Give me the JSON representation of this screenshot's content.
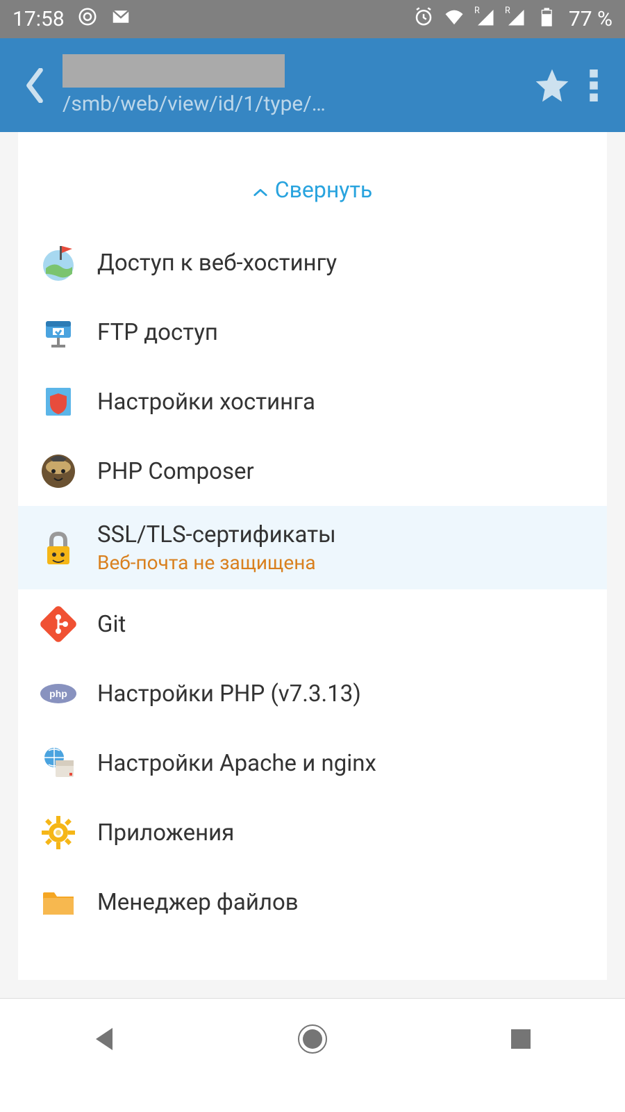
{
  "status": {
    "time": "17:58",
    "battery": "77 %"
  },
  "header": {
    "path": "/smb/web/view/id/1/type/…"
  },
  "collapse": {
    "label": "Свернуть"
  },
  "menu": [
    {
      "label": "Доступ к веб-хостингу",
      "icon": "globe-flag",
      "sublabel": null,
      "selected": false
    },
    {
      "label": "FTP доступ",
      "icon": "ftp",
      "sublabel": null,
      "selected": false
    },
    {
      "label": "Настройки хостинга",
      "icon": "hosting-shield",
      "sublabel": null,
      "selected": false
    },
    {
      "label": "PHP Composer",
      "icon": "composer",
      "sublabel": null,
      "selected": false
    },
    {
      "label": "SSL/TLS-сертификаты",
      "icon": "lock",
      "sublabel": "Веб-почта не защищена",
      "selected": true
    },
    {
      "label": "Git",
      "icon": "git",
      "sublabel": null,
      "selected": false
    },
    {
      "label": "Настройки PHP (v7.3.13)",
      "icon": "php",
      "sublabel": null,
      "selected": false
    },
    {
      "label": "Настройки Apache и nginx",
      "icon": "servers",
      "sublabel": null,
      "selected": false
    },
    {
      "label": "Приложения",
      "icon": "gear",
      "sublabel": null,
      "selected": false
    },
    {
      "label": "Менеджер файлов",
      "icon": "folder",
      "sublabel": null,
      "selected": false
    }
  ]
}
